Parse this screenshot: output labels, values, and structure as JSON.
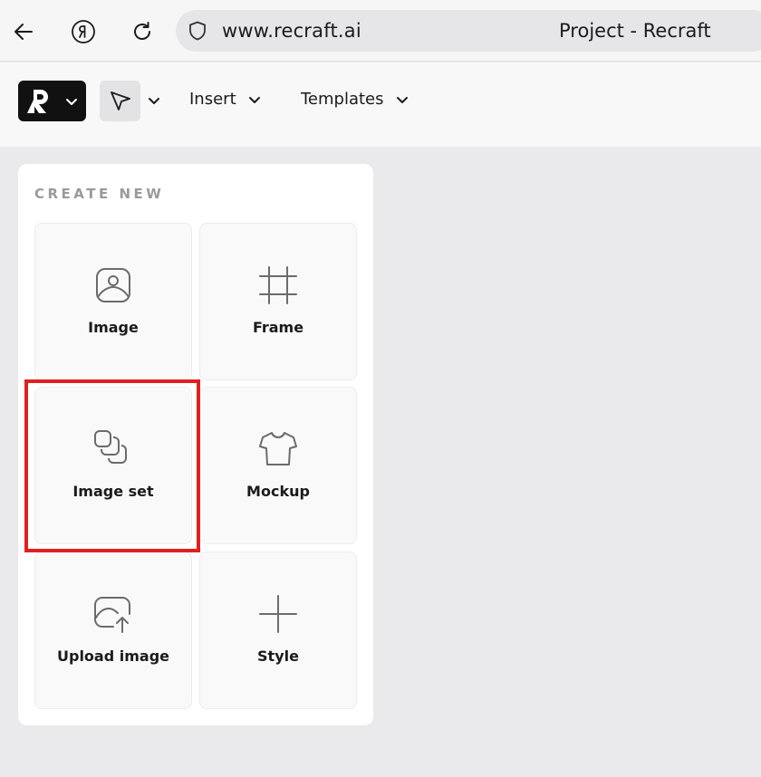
{
  "browser": {
    "url": "www.recraft.ai",
    "tab_title": "Project - Recraft"
  },
  "toolbar": {
    "insert_label": "Insert",
    "templates_label": "Templates"
  },
  "panel": {
    "title": "CREATE NEW",
    "cards": [
      {
        "label": "Image",
        "icon": "image-icon"
      },
      {
        "label": "Frame",
        "icon": "frame-icon"
      },
      {
        "label": "Image set",
        "icon": "image-set-icon"
      },
      {
        "label": "Mockup",
        "icon": "tshirt-icon"
      },
      {
        "label": "Upload image",
        "icon": "upload-image-icon"
      },
      {
        "label": "Style",
        "icon": "plus-icon"
      }
    ]
  },
  "colors": {
    "highlight": "#e02020",
    "logo_bg": "#111111",
    "background": "#eaeaed"
  }
}
